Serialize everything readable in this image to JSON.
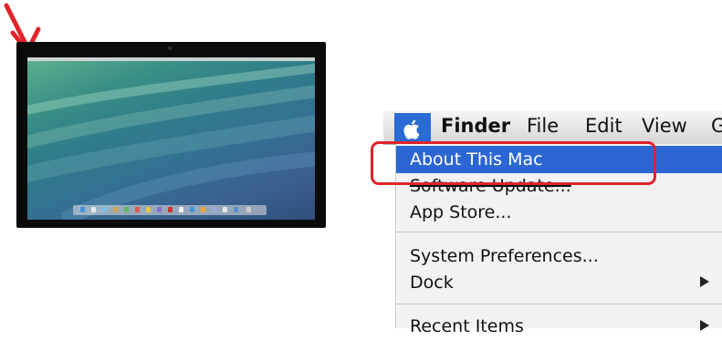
{
  "colors": {
    "accent_blue": "#2b66d3",
    "annotation_red": "#e0242a"
  },
  "illustration": {
    "monitor_icon": "imac-icon",
    "arrow_icon": "red-arrow-icon"
  },
  "menubar": {
    "apple_icon": "apple-icon",
    "items": [
      "Finder",
      "File",
      "Edit",
      "View",
      "G"
    ]
  },
  "apple_menu": {
    "items": [
      {
        "label": "About This Mac",
        "selected": true
      },
      {
        "label": "Software Update...",
        "struck": true
      },
      {
        "label": "App Store..."
      },
      {
        "label": "System Preferences..."
      },
      {
        "label": "Dock",
        "submenu": true
      },
      {
        "label": "Recent Items",
        "submenu": true
      }
    ]
  }
}
